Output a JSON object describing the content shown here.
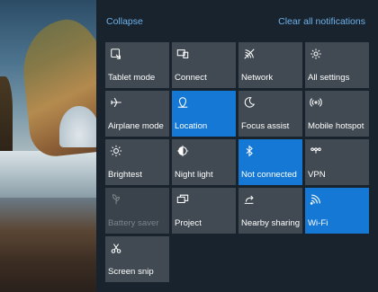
{
  "header": {
    "collapse_label": "Collapse",
    "clear_label": "Clear all notifications"
  },
  "colors": {
    "accent": "#1478d4",
    "tile": "#414a52",
    "link": "#6fb1ea",
    "panel": "#18232e"
  },
  "tiles": [
    {
      "label": "Tablet mode",
      "icon": "tablet-mode-icon",
      "state": "off"
    },
    {
      "label": "Connect",
      "icon": "connect-icon",
      "state": "off"
    },
    {
      "label": "Network",
      "icon": "network-icon",
      "state": "off"
    },
    {
      "label": "All settings",
      "icon": "gear-icon",
      "state": "off"
    },
    {
      "label": "Airplane mode",
      "icon": "airplane-icon",
      "state": "off"
    },
    {
      "label": "Location",
      "icon": "location-icon",
      "state": "on"
    },
    {
      "label": "Focus assist",
      "icon": "moon-icon",
      "state": "off"
    },
    {
      "label": "Mobile hotspot",
      "icon": "hotspot-icon",
      "state": "off"
    },
    {
      "label": "Brightest",
      "icon": "brightness-icon",
      "state": "off"
    },
    {
      "label": "Night light",
      "icon": "night-light-icon",
      "state": "off"
    },
    {
      "label": "Not connected",
      "icon": "bluetooth-icon",
      "state": "on"
    },
    {
      "label": "VPN",
      "icon": "vpn-icon",
      "state": "off"
    },
    {
      "label": "Battery saver",
      "icon": "battery-saver-icon",
      "state": "disabled"
    },
    {
      "label": "Project",
      "icon": "project-icon",
      "state": "off"
    },
    {
      "label": "Nearby sharing",
      "icon": "nearby-sharing-icon",
      "state": "off"
    },
    {
      "label": "Wi-Fi",
      "icon": "wifi-icon",
      "state": "on"
    },
    {
      "label": "Screen snip",
      "icon": "screen-snip-icon",
      "state": "off"
    }
  ]
}
